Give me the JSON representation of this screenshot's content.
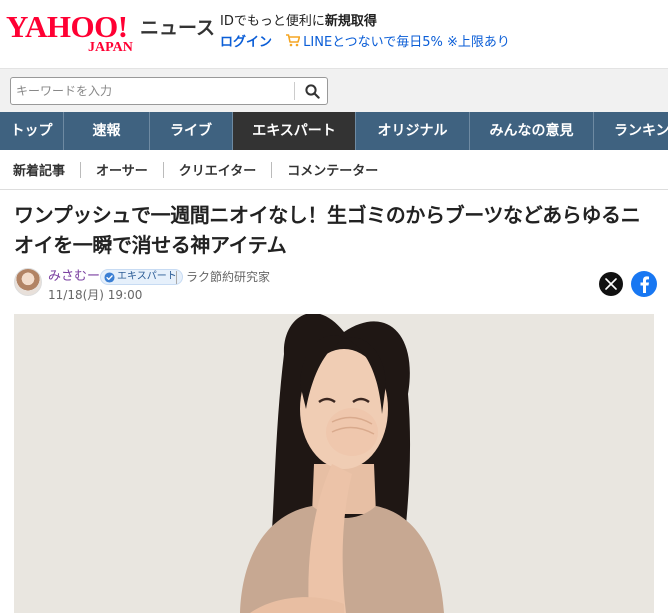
{
  "header": {
    "logo_text": "YAHOO!",
    "logo_sub": "JAPAN",
    "site_name": "ニュース",
    "id_message_prefix": "IDでもっと便利に",
    "id_message_bold": "新規取得",
    "login_label": "ログイン",
    "line_link": "LINEとつないで毎日5% ※上限あり"
  },
  "search": {
    "placeholder": "キーワードを入力",
    "icon": "search-icon"
  },
  "main_nav": {
    "items": [
      {
        "label": "トップ",
        "active": false
      },
      {
        "label": "速報",
        "active": false
      },
      {
        "label": "ライブ",
        "active": false
      },
      {
        "label": "エキスパート",
        "active": true
      },
      {
        "label": "オリジナル",
        "active": false
      },
      {
        "label": "みんなの意見",
        "active": false
      },
      {
        "label": "ランキン",
        "active": false
      }
    ]
  },
  "sub_nav": {
    "items": [
      "新着記事",
      "オーサー",
      "クリエイター",
      "コメンテーター"
    ]
  },
  "article": {
    "title": "ワンプッシュで一週間ニオイなし！生ゴミのからブーツなどあらゆるニオイを一瞬で消せる神アイテム",
    "author": "みさむー",
    "badge": "エキスパート",
    "organization": "ラク節約研究家",
    "date": "11/18(月) 19:00"
  },
  "share": {
    "x_icon": "x-icon",
    "facebook_icon": "facebook-icon"
  },
  "colors": {
    "brand_red": "#ff0033",
    "nav_bg": "#3f6280",
    "nav_active": "#333333",
    "link_blue": "#0b5ed7",
    "author_purple": "#7a3fa0",
    "facebook_blue": "#1877f2"
  }
}
